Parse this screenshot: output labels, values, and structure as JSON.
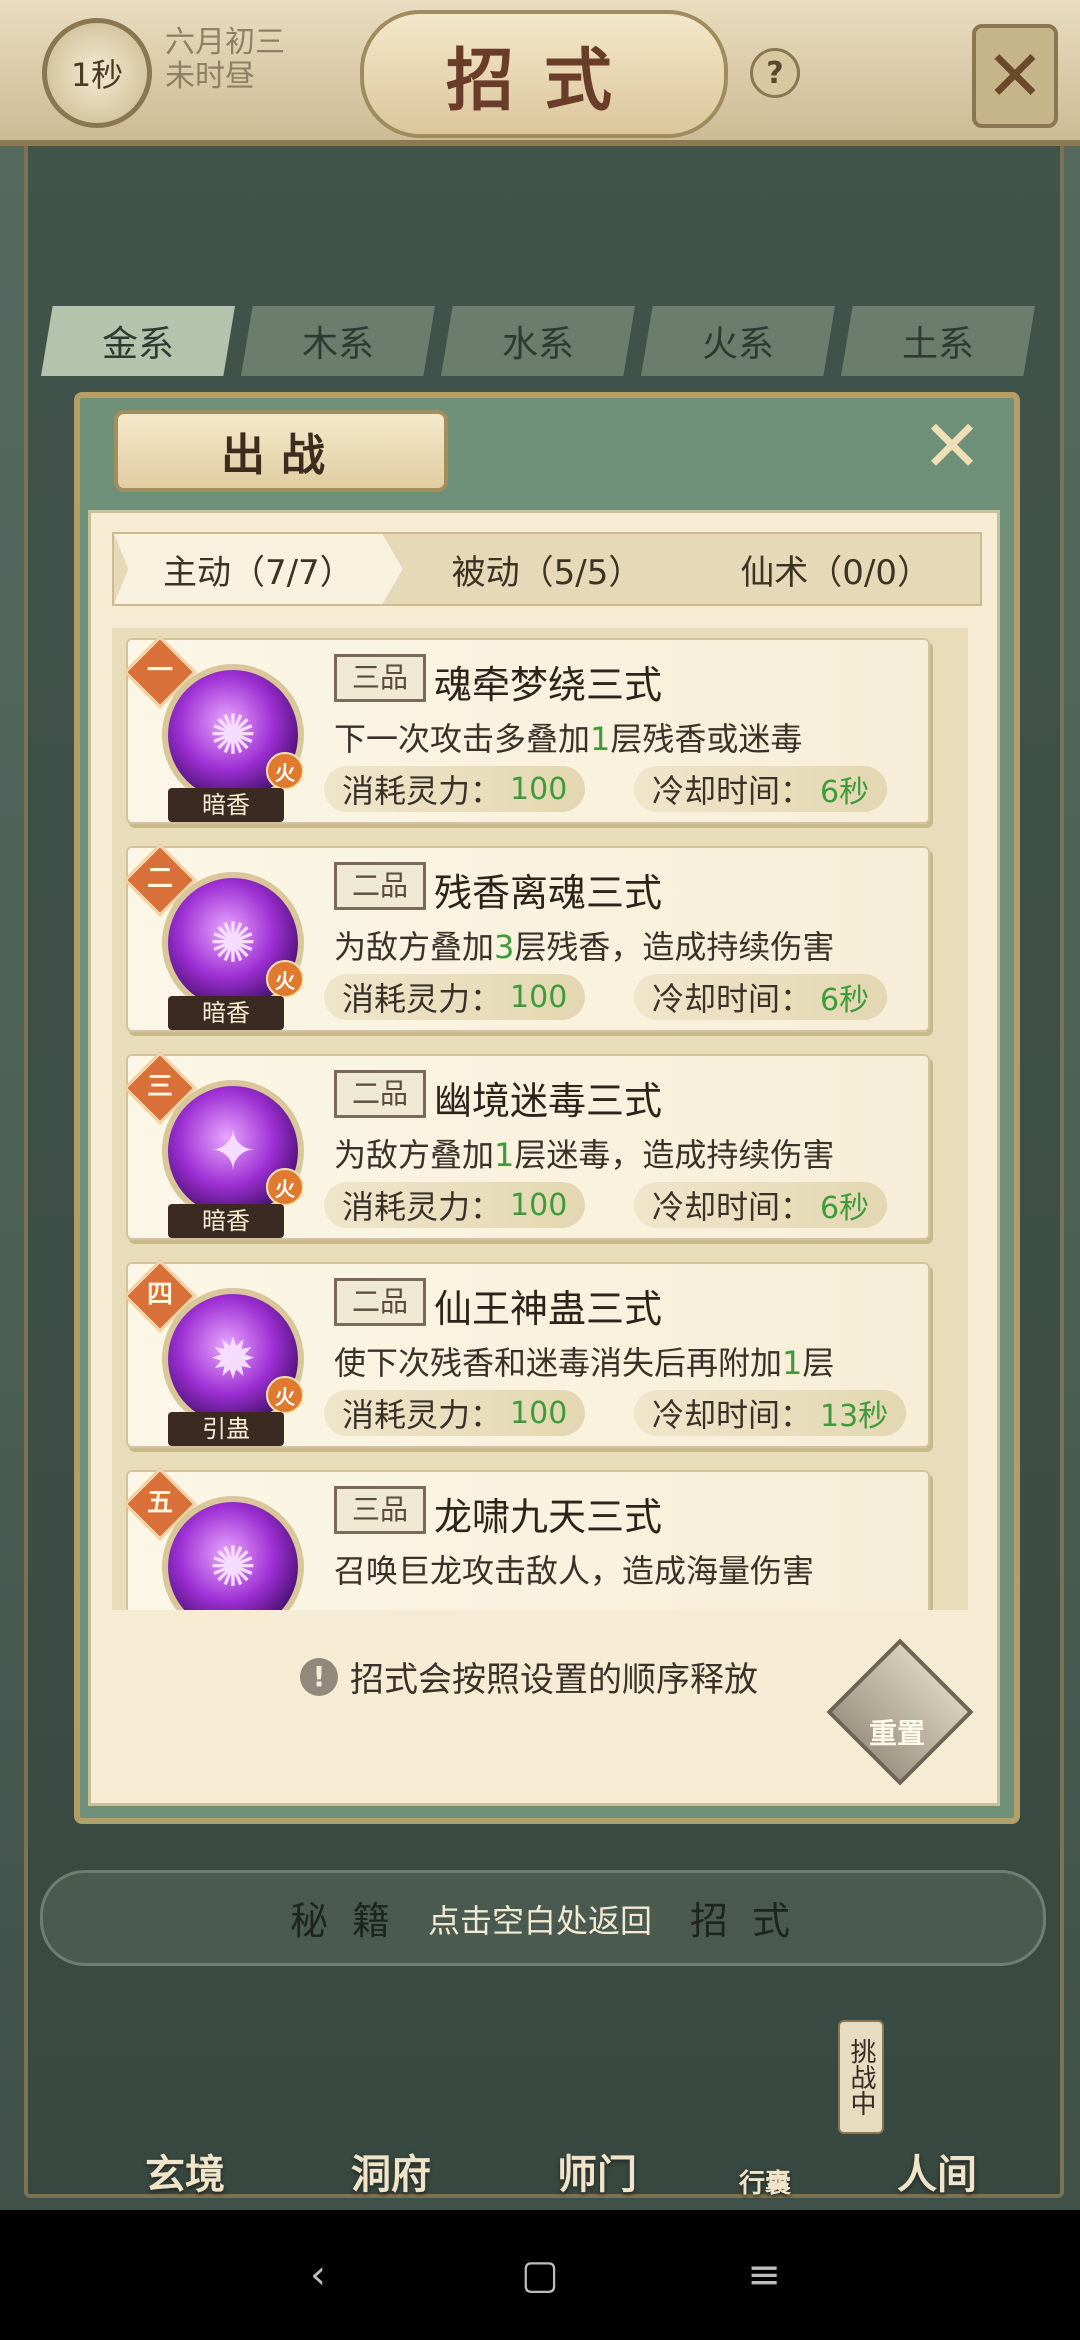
{
  "header": {
    "timer": "1秒",
    "lunar_date": "六月初三",
    "lunar_time": "未时昼",
    "title": "招式",
    "help": "?"
  },
  "element_tabs": [
    "金系",
    "木系",
    "水系",
    "火系",
    "土系"
  ],
  "modal": {
    "title": "出战",
    "sub_tabs": [
      "主动（7/7）",
      "被动（5/5）",
      "仙术（0/0）"
    ],
    "skills": [
      {
        "rank": "一",
        "name": "魂牵梦绕三式",
        "grade": "三品",
        "desc_pre": "下一次攻击多叠加",
        "desc_num": "1",
        "desc_post": "层残香或迷毒",
        "mp_label": "消耗灵力：",
        "mp": "100",
        "cd_label": "冷却时间：",
        "cd": "6秒",
        "type_label": "暗香",
        "element": "火"
      },
      {
        "rank": "二",
        "name": "残香离魂三式",
        "grade": "二品",
        "desc_pre": "为敌方叠加",
        "desc_num": "3",
        "desc_post": "层残香，造成持续伤害",
        "mp_label": "消耗灵力：",
        "mp": "100",
        "cd_label": "冷却时间：",
        "cd": "6秒",
        "type_label": "暗香",
        "element": "火"
      },
      {
        "rank": "三",
        "name": "幽境迷毒三式",
        "grade": "二品",
        "desc_pre": "为敌方叠加",
        "desc_num": "1",
        "desc_post": "层迷毒，造成持续伤害",
        "mp_label": "消耗灵力：",
        "mp": "100",
        "cd_label": "冷却时间：",
        "cd": "6秒",
        "type_label": "暗香",
        "element": "火"
      },
      {
        "rank": "四",
        "name": "仙王神蛊三式",
        "grade": "二品",
        "desc_pre": "使下次残香和迷毒消失后再附加",
        "desc_num": "1",
        "desc_post": "层",
        "mp_label": "消耗灵力：",
        "mp": "100",
        "cd_label": "冷却时间：",
        "cd": "13秒",
        "type_label": "引蛊",
        "element": "火"
      },
      {
        "rank": "五",
        "name": "龙啸九天三式",
        "grade": "三品",
        "desc_pre": "召唤巨龙攻击敌人，造成海量伤害",
        "desc_num": "",
        "desc_post": "",
        "mp_label": "",
        "mp": "",
        "cd_label": "",
        "cd": "",
        "type_label": "",
        "element": ""
      }
    ],
    "notice": "招式会按照设置的顺序释放",
    "notice_icon": "!",
    "reset_label": "重置"
  },
  "bottom": {
    "left": "秘籍",
    "hint": "点击空白处返回",
    "right": "招式"
  },
  "nav": [
    "玄境",
    "洞府",
    "师门",
    "行囊",
    "人间"
  ],
  "challenge": "挑战中",
  "colors": {
    "accent_green": "#3f9a3a",
    "rank_orange": "#d9703a",
    "skill_purple": "#9d2fd3"
  }
}
